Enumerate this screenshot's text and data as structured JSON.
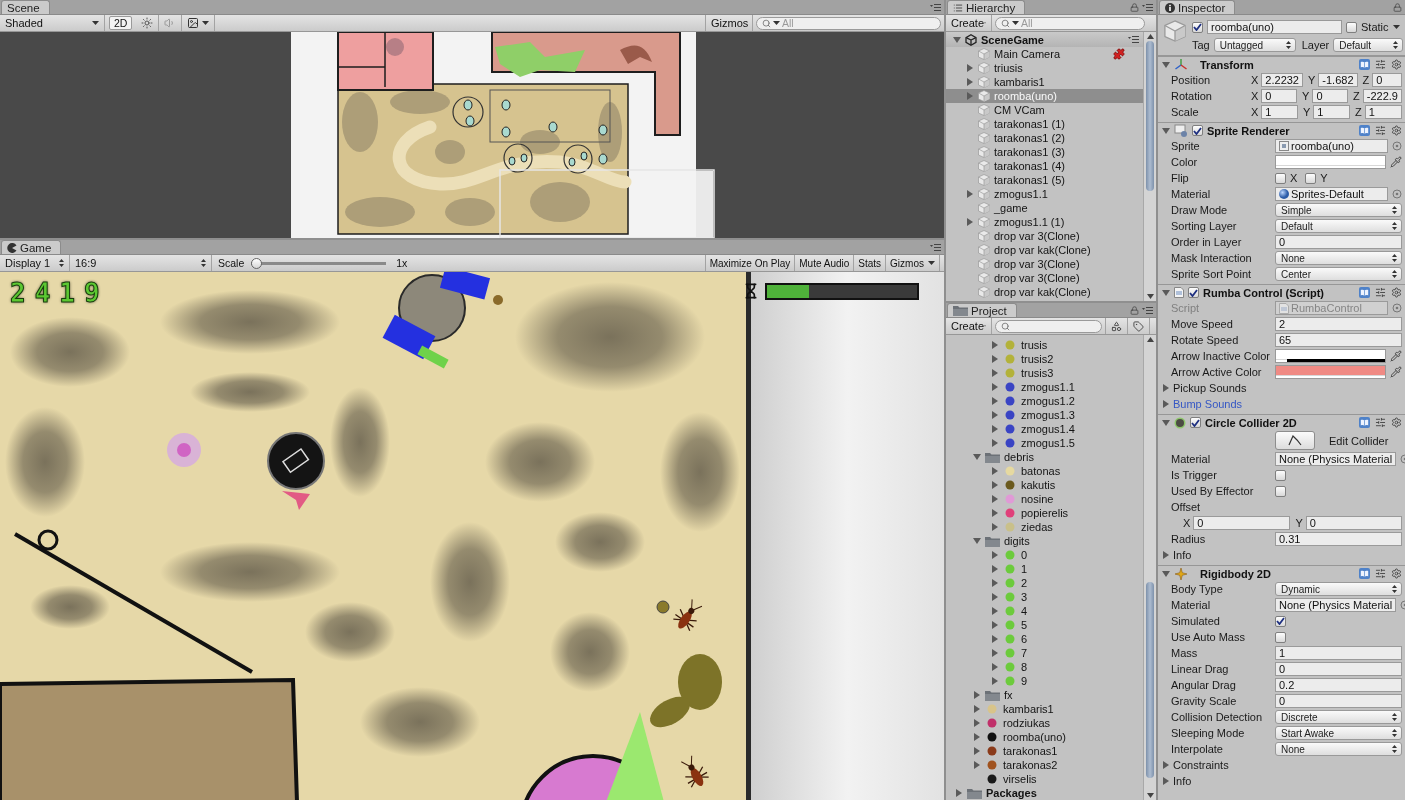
{
  "scene": {
    "tab": "Scene",
    "toolbar": {
      "shading": "Shaded",
      "mode_2d": {
        "label": "2D",
        "selected": true
      },
      "gizmos": "Gizmos",
      "search": {
        "placeholder": "All"
      }
    }
  },
  "game": {
    "tab": "Game",
    "toolbar": {
      "display": "Display 1",
      "aspect": "16:9",
      "scale": {
        "label": "Scale",
        "level": 0,
        "reading": "1x"
      },
      "buttons": [
        {
          "label": "Maximize On Play",
          "kind": "toggle"
        },
        {
          "label": "Mute Audio",
          "kind": "toggle"
        },
        {
          "label": "Stats",
          "kind": "toggle"
        },
        {
          "label": "Gizmos",
          "kind": "menu"
        }
      ]
    },
    "hud": {
      "score": "2419",
      "timer": {
        "level": 0.28
      }
    }
  },
  "hierarchy": {
    "tab": "Hierarchy",
    "create": "Create",
    "search": {
      "placeholder": "All"
    },
    "scene": {
      "name": "SceneGame",
      "expanded": true
    },
    "items": [
      {
        "name": "Main Camera",
        "kind": "leaf",
        "selected": false,
        "badge": true
      },
      {
        "name": "triusis",
        "kind": "branch",
        "expanded": false,
        "selected": false
      },
      {
        "name": "kambaris1",
        "kind": "branch",
        "expanded": false,
        "selected": false
      },
      {
        "name": "roomba(uno)",
        "kind": "branch",
        "expanded": false,
        "selected": true
      },
      {
        "name": "CM VCam",
        "kind": "leaf",
        "selected": false
      },
      {
        "name": "tarakonas1 (1)",
        "kind": "leaf",
        "selected": false
      },
      {
        "name": "tarakonas1 (2)",
        "kind": "leaf",
        "selected": false
      },
      {
        "name": "tarakonas1 (3)",
        "kind": "leaf",
        "selected": false
      },
      {
        "name": "tarakonas1 (4)",
        "kind": "leaf",
        "selected": false
      },
      {
        "name": "tarakonas1 (5)",
        "kind": "leaf",
        "selected": false
      },
      {
        "name": "zmogus1.1",
        "kind": "branch",
        "expanded": false,
        "selected": false
      },
      {
        "name": "_game",
        "kind": "leaf",
        "selected": false
      },
      {
        "name": "zmogus1.1 (1)",
        "kind": "branch",
        "expanded": false,
        "selected": false
      },
      {
        "name": "drop var 3(Clone)",
        "kind": "leaf",
        "selected": false
      },
      {
        "name": "drop var kak(Clone)",
        "kind": "leaf",
        "selected": false
      },
      {
        "name": "drop var 3(Clone)",
        "kind": "leaf",
        "selected": false
      },
      {
        "name": "drop var 3(Clone)",
        "kind": "leaf",
        "selected": false
      },
      {
        "name": "drop var kak(Clone)",
        "kind": "leaf",
        "selected": false
      }
    ]
  },
  "project": {
    "tab": "Project",
    "create": "Create",
    "tree": [
      {
        "children": [
          {
            "children": [
              {
                "name": "trusis",
                "kind": "sprite",
                "color": "#b3b23a",
                "expanded": false
              },
              {
                "name": "trusis2",
                "kind": "sprite",
                "color": "#b3b23a",
                "expanded": false
              },
              {
                "name": "trusis3",
                "kind": "sprite",
                "color": "#b3b23a",
                "expanded": false
              },
              {
                "name": "zmogus1.1",
                "kind": "sprite",
                "color": "#3a44c4",
                "expanded": false
              },
              {
                "name": "zmogus1.2",
                "kind": "sprite",
                "color": "#3a44c4",
                "expanded": false
              },
              {
                "name": "zmogus1.3",
                "kind": "sprite",
                "color": "#3a44c4",
                "expanded": false
              },
              {
                "name": "zmogus1.4",
                "kind": "sprite",
                "color": "#3a44c4",
                "expanded": false
              },
              {
                "name": "zmogus1.5",
                "kind": "sprite",
                "color": "#3a44c4",
                "expanded": false
              }
            ]
          },
          {
            "name": "debris",
            "kind": "folder",
            "expanded": true,
            "children": [
              {
                "name": "batonas",
                "kind": "sprite",
                "color": "#e6d9a0",
                "expanded": false
              },
              {
                "name": "kakutis",
                "kind": "sprite",
                "color": "#6b5a1e",
                "expanded": false
              },
              {
                "name": "nosine",
                "kind": "sprite",
                "color": "#e09ad6",
                "expanded": false
              },
              {
                "name": "popierelis",
                "kind": "sprite",
                "color": "#e0407a",
                "expanded": false
              },
              {
                "name": "ziedas",
                "kind": "sprite",
                "color": "#c9c08a",
                "expanded": false
              }
            ]
          },
          {
            "name": "digits",
            "kind": "folder",
            "expanded": true,
            "children": [
              {
                "name": "0",
                "kind": "sprite",
                "color": "#6ccb3c",
                "expanded": false
              },
              {
                "name": "1",
                "kind": "sprite",
                "color": "#6ccb3c",
                "expanded": false
              },
              {
                "name": "2",
                "kind": "sprite",
                "color": "#6ccb3c",
                "expanded": false
              },
              {
                "name": "3",
                "kind": "sprite",
                "color": "#6ccb3c",
                "expanded": false
              },
              {
                "name": "4",
                "kind": "sprite",
                "color": "#6ccb3c",
                "expanded": false
              },
              {
                "name": "5",
                "kind": "sprite",
                "color": "#6ccb3c",
                "expanded": false
              },
              {
                "name": "6",
                "kind": "sprite",
                "color": "#6ccb3c",
                "expanded": false
              },
              {
                "name": "7",
                "kind": "sprite",
                "color": "#6ccb3c",
                "expanded": false
              },
              {
                "name": "8",
                "kind": "sprite",
                "color": "#6ccb3c",
                "expanded": false
              },
              {
                "name": "9",
                "kind": "sprite",
                "color": "#6ccb3c",
                "expanded": false
              }
            ]
          },
          {
            "name": "fx",
            "kind": "folder",
            "expanded": false
          },
          {
            "name": "kambaris1",
            "kind": "sprite",
            "color": "#d8c48a",
            "expanded": false
          },
          {
            "name": "rodziukas",
            "kind": "sprite",
            "color": "#c0306a",
            "expanded": false
          },
          {
            "name": "roomba(uno)",
            "kind": "sprite",
            "color": "#111111",
            "expanded": false
          },
          {
            "name": "tarakonas1",
            "kind": "sprite",
            "color": "#8a3a1a",
            "expanded": false
          },
          {
            "name": "tarakonas2",
            "kind": "sprite",
            "color": "#a0521e",
            "expanded": false
          },
          {
            "name": "virselis",
            "kind": "sprite",
            "color": "#1a1a1a"
          }
        ]
      },
      {
        "name": "Packages",
        "kind": "folder",
        "expanded": false
      }
    ]
  },
  "inspector": {
    "tab": "Inspector",
    "object": {
      "active": true,
      "name": "roomba(uno)",
      "static": {
        "label": "Static",
        "checked": false
      },
      "tag": {
        "label": "Tag",
        "value": "Untagged"
      },
      "layer": {
        "label": "Layer",
        "value": "Default"
      }
    },
    "components": [
      {
        "kind": "transform",
        "title": "Transform",
        "expanded": true,
        "fields": [
          {
            "kind": "vector3",
            "label": "Position",
            "axes": [
              {
                "axis": "X",
                "value": "2.2232"
              },
              {
                "axis": "Y",
                "value": "-1.682"
              },
              {
                "axis": "Z",
                "value": "0"
              }
            ]
          },
          {
            "kind": "vector3",
            "label": "Rotation",
            "axes": [
              {
                "axis": "X",
                "value": "0"
              },
              {
                "axis": "Y",
                "value": "0"
              },
              {
                "axis": "Z",
                "value": "-222.9"
              }
            ]
          },
          {
            "kind": "vector3",
            "label": "Scale",
            "axes": [
              {
                "axis": "X",
                "value": "1"
              },
              {
                "axis": "Y",
                "value": "1"
              },
              {
                "axis": "Z",
                "value": "1"
              }
            ]
          }
        ]
      },
      {
        "kind": "sprite_renderer",
        "title": "Sprite Renderer",
        "enabled": true,
        "expanded": true,
        "fields": [
          {
            "kind": "sprite_ref",
            "label": "Sprite",
            "value": "roomba(uno)"
          },
          {
            "kind": "color",
            "label": "Color",
            "color": "#ffffff",
            "level": 1
          },
          {
            "kind": "flip",
            "label": "Flip",
            "options": [
              {
                "label": "X",
                "checked": false
              },
              {
                "label": "Y",
                "checked": false
              }
            ]
          },
          {
            "kind": "material_ref",
            "label": "Material",
            "value": "Sprites-Default"
          },
          {
            "kind": "dropdown",
            "label": "Draw Mode",
            "value": "Simple"
          },
          {
            "kind": "dropdown",
            "label": "Sorting Layer",
            "value": "Default"
          },
          {
            "kind": "text",
            "label": "Order in Layer",
            "value": "0"
          },
          {
            "kind": "dropdown",
            "label": "Mask Interaction",
            "value": "None"
          },
          {
            "kind": "dropdown",
            "label": "Sprite Sort Point",
            "value": "Center"
          }
        ]
      },
      {
        "kind": "script",
        "title": "Rumba Control (Script)",
        "enabled": true,
        "expanded": true,
        "fields": [
          {
            "kind": "script_ref",
            "label": "Script",
            "value": "RumbaControl",
            "disabled": true
          },
          {
            "kind": "text",
            "label": "Move Speed",
            "value": "2"
          },
          {
            "kind": "text",
            "label": "Rotate Speed",
            "value": "65"
          },
          {
            "kind": "color",
            "label": "Arrow Inactive Color",
            "color": "#ffffff",
            "level": 0.1
          },
          {
            "kind": "color",
            "label": "Arrow Active Color",
            "color": "#f08a84",
            "level": 1
          },
          {
            "kind": "foldout",
            "label": "Pickup Sounds",
            "expanded": false,
            "overridden": false
          },
          {
            "kind": "foldout",
            "label": "Bump Sounds",
            "expanded": false,
            "overridden": true
          }
        ]
      },
      {
        "kind": "circle_collider",
        "title": "Circle Collider 2D",
        "enabled": true,
        "expanded": true,
        "fields": [
          {
            "kind": "button",
            "label": "Edit Collider"
          },
          {
            "kind": "object_ref",
            "label": "Material",
            "value": "None (Physics Material"
          },
          {
            "kind": "checkbox",
            "label": "Is Trigger",
            "checked": false
          },
          {
            "kind": "checkbox",
            "label": "Used By Effector",
            "checked": false
          },
          {
            "kind": "heading",
            "label": "Offset"
          },
          {
            "kind": "vector2",
            "axes": [
              {
                "axis": "X",
                "value": "0"
              },
              {
                "axis": "Y",
                "value": "0"
              }
            ]
          },
          {
            "kind": "text",
            "label": "Radius",
            "value": "0.31"
          },
          {
            "kind": "foldout",
            "label": "Info",
            "expanded": false,
            "overridden": false
          }
        ]
      },
      {
        "kind": "rigidbody",
        "title": "Rigidbody 2D",
        "expanded": true,
        "fields": [
          {
            "kind": "dropdown",
            "label": "Body Type",
            "value": "Dynamic"
          },
          {
            "kind": "object_ref",
            "label": "Material",
            "value": "None (Physics Material"
          },
          {
            "kind": "checkbox",
            "label": "Simulated",
            "checked": true
          },
          {
            "kind": "checkbox",
            "label": "Use Auto Mass",
            "checked": false
          },
          {
            "kind": "text",
            "label": "Mass",
            "value": "1"
          },
          {
            "kind": "text",
            "label": "Linear Drag",
            "value": "0"
          },
          {
            "kind": "text",
            "label": "Angular Drag",
            "value": "0.2"
          },
          {
            "kind": "text",
            "label": "Gravity Scale",
            "value": "0"
          },
          {
            "kind": "dropdown",
            "label": "Collision Detection",
            "value": "Discrete"
          },
          {
            "kind": "dropdown",
            "label": "Sleeping Mode",
            "value": "Start Awake"
          },
          {
            "kind": "dropdown",
            "label": "Interpolate",
            "value": "None"
          },
          {
            "kind": "foldout",
            "label": "Constraints",
            "expanded": false,
            "overridden": false
          },
          {
            "kind": "foldout",
            "label": "Info",
            "expanded": false,
            "overridden": false
          }
        ]
      }
    ]
  }
}
